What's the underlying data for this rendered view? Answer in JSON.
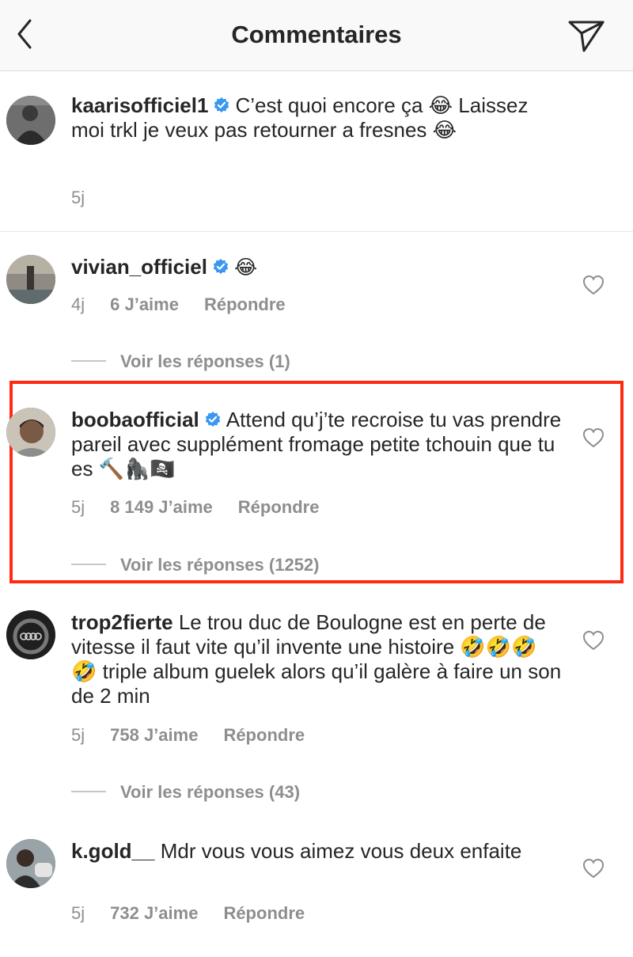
{
  "header": {
    "title": "Commentaires",
    "back_icon": "chevron-left-icon",
    "share_icon": "paper-plane-icon"
  },
  "colors": {
    "highlight_border": "#ff2a12",
    "verified_badge": "#3897f0",
    "meta_text": "#8e8e8e"
  },
  "comments": [
    {
      "username": "kaarisofficiel1",
      "verified": true,
      "text": "C’est quoi encore ça 😂 Laissez moi trkl je veux pas retourner a fresnes 😂",
      "time": "5j"
    },
    {
      "username": "vivian_officiel",
      "verified": true,
      "text": "😂",
      "time": "4j",
      "likes": "6 J’aime",
      "reply_label": "Répondre",
      "view_replies": "Voir les réponses (1)"
    },
    {
      "username": "boobaofficial",
      "verified": true,
      "text": "Attend qu’j’te recroise tu vas prendre pareil avec supplément fromage petite tchouin que tu es 🔨🦍🏴‍☠️",
      "time": "5j",
      "likes": "8 149 J’aime",
      "reply_label": "Répondre",
      "view_replies": "Voir les réponses (1252)"
    },
    {
      "username": "trop2fierte",
      "verified": false,
      "text": "Le trou duc de Boulogne est en perte de vitesse il faut vite qu’il invente une histoire 🤣🤣🤣🤣 triple album guelek alors qu’il galère à faire un son de 2 min",
      "time": "5j",
      "likes": "758 J’aime",
      "reply_label": "Répondre",
      "view_replies": "Voir les réponses (43)"
    },
    {
      "username": "k.gold__",
      "verified": false,
      "text": "Mdr vous vous aimez vous deux enfaite",
      "time": "5j",
      "likes": "732 J’aime",
      "reply_label": "Répondre"
    }
  ]
}
